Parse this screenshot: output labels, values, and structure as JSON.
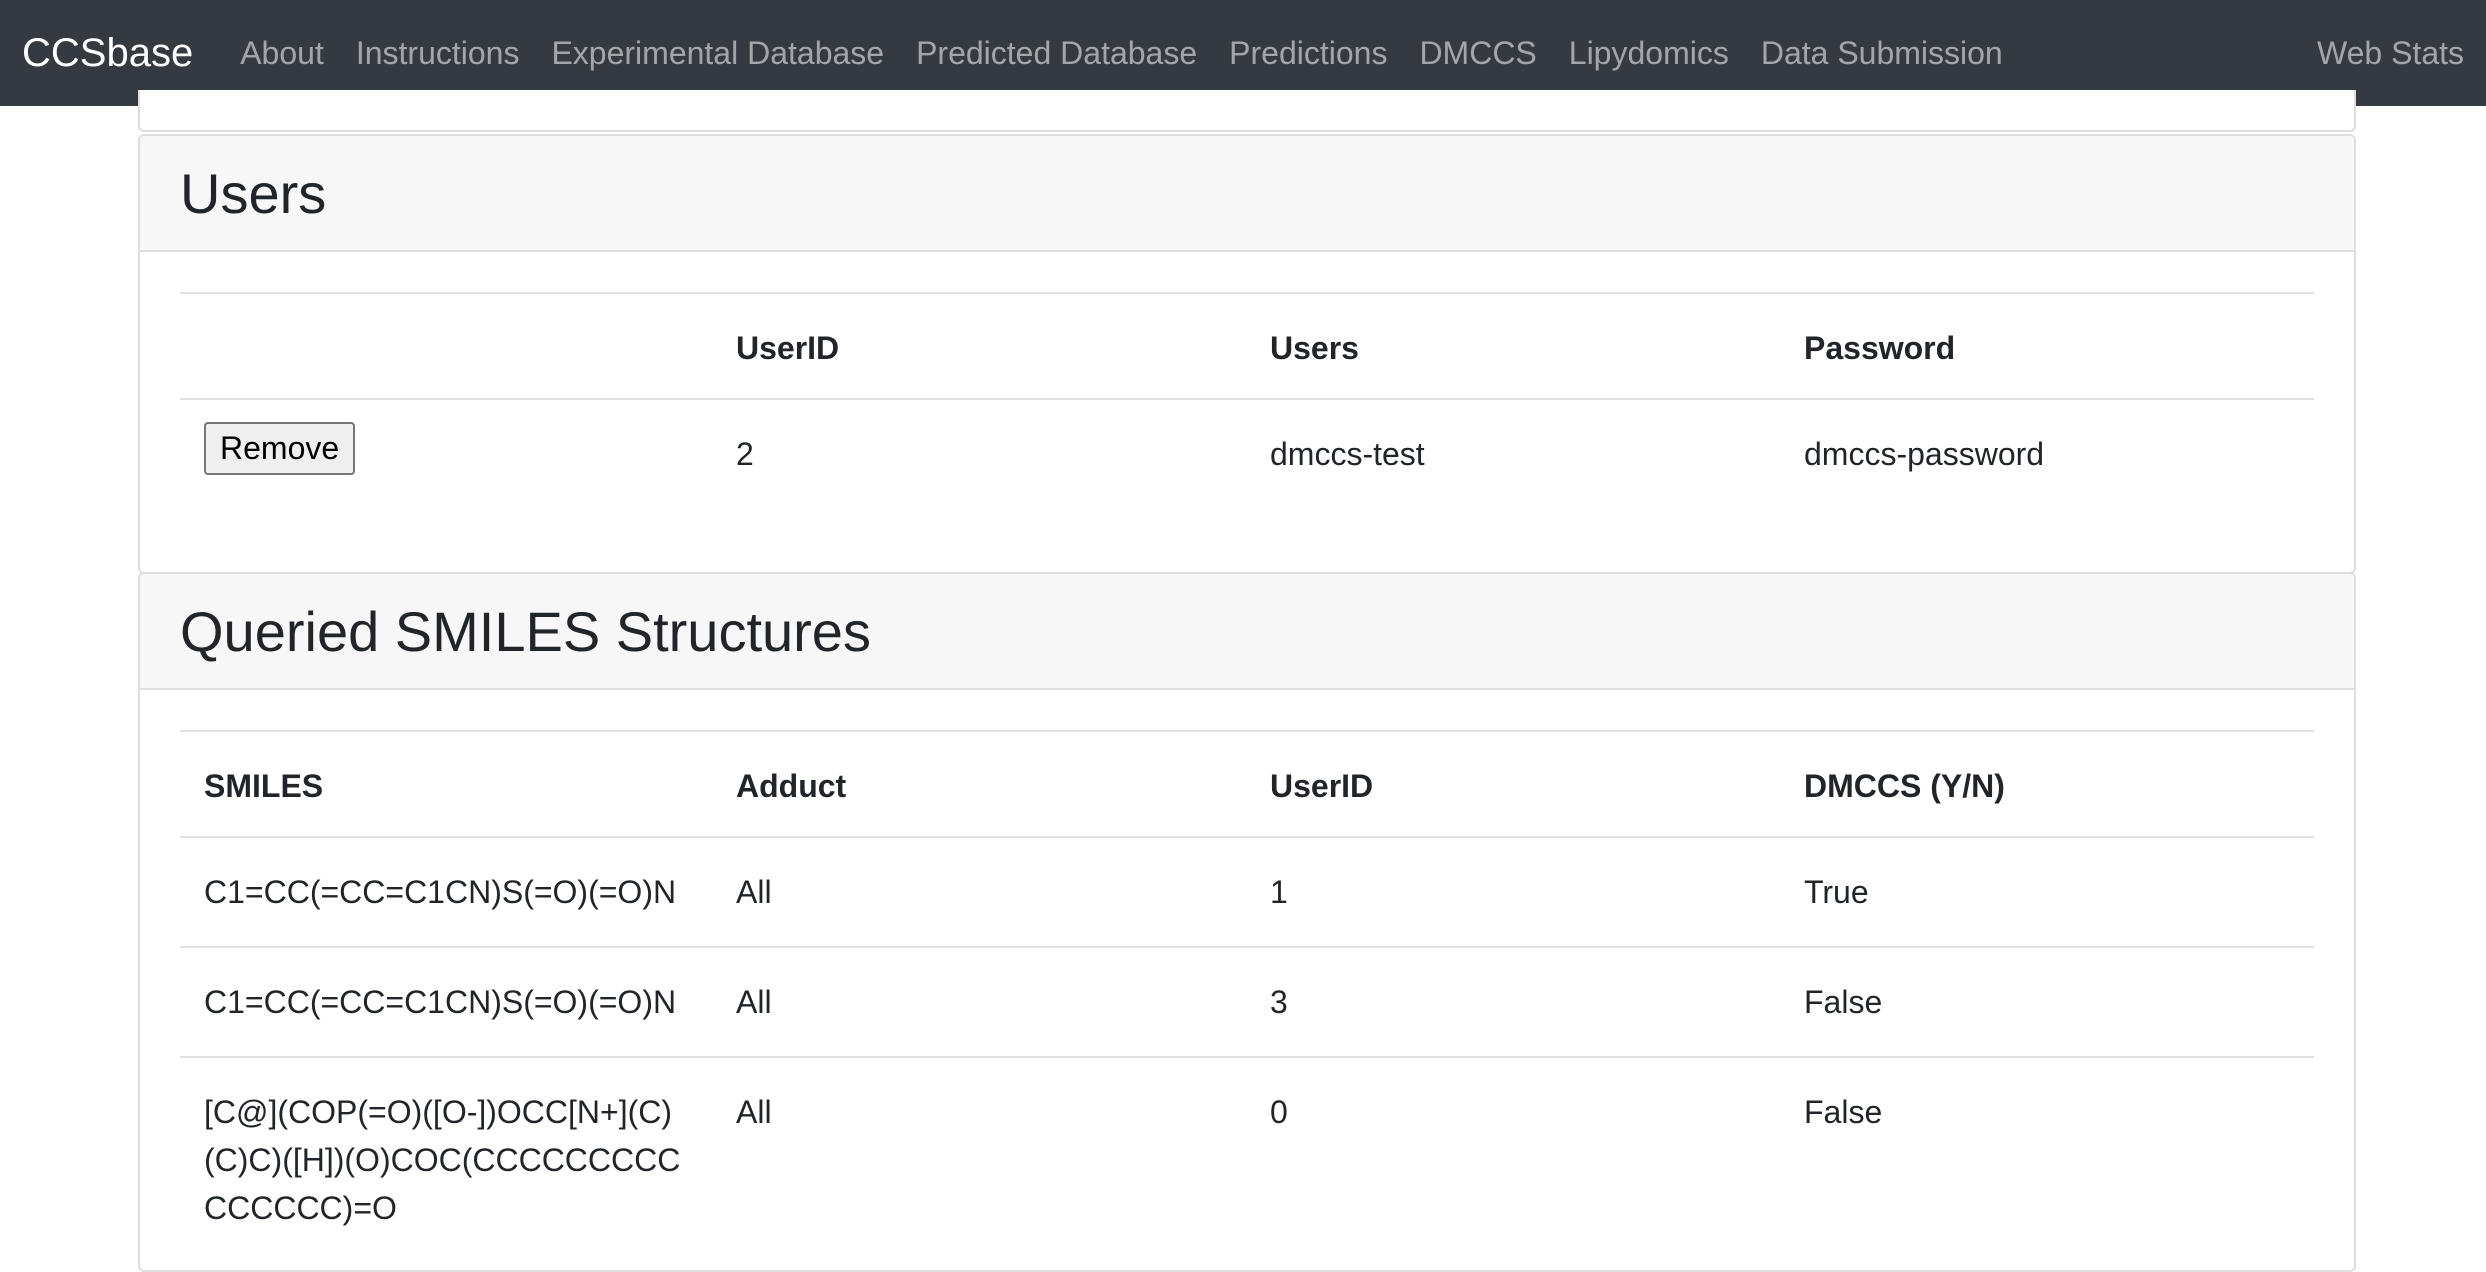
{
  "navbar": {
    "brand": "CCSbase",
    "items": [
      {
        "label": "About"
      },
      {
        "label": "Instructions"
      },
      {
        "label": "Experimental Database"
      },
      {
        "label": "Predicted Database"
      },
      {
        "label": "Predictions"
      },
      {
        "label": "DMCCS"
      },
      {
        "label": "Lipydomics"
      },
      {
        "label": "Data Submission"
      }
    ],
    "right_item": "Web Stats"
  },
  "users_card": {
    "title": "Users",
    "headers": [
      "",
      "UserID",
      "Users",
      "Password"
    ],
    "rows": [
      {
        "action": "Remove",
        "user_id": "2",
        "user": "dmccs-test",
        "password": "dmccs-password"
      }
    ]
  },
  "smiles_card": {
    "title": "Queried SMILES Structures",
    "headers": [
      "SMILES",
      "Adduct",
      "UserID",
      "DMCCS (Y/N)"
    ],
    "rows": [
      {
        "smiles": "C1=CC(=CC=C1CN)S(=O)(=O)N",
        "adduct": "All",
        "user_id": "1",
        "dmccs": "True"
      },
      {
        "smiles": "C1=CC(=CC=C1CN)S(=O)(=O)N",
        "adduct": "All",
        "user_id": "3",
        "dmccs": "False"
      },
      {
        "smiles": "[C@](COP(=O)([O-])OCC[N+](C)(C)C)([H])(O)COC(CCCCCCCCCCCCCCC)=O",
        "adduct": "All",
        "user_id": "0",
        "dmccs": "False"
      }
    ]
  }
}
